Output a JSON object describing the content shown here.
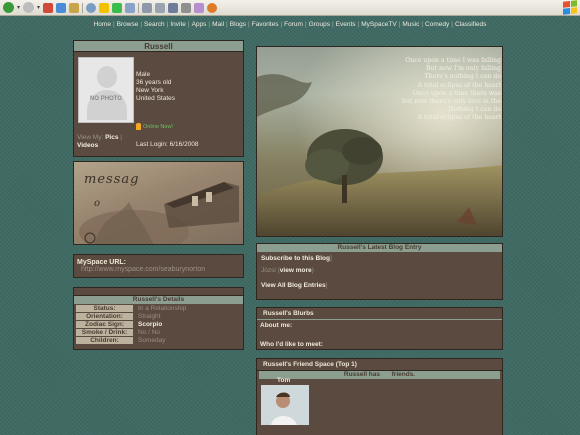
{
  "nav": [
    "Home",
    "Browse",
    "Search",
    "Invite",
    "Apps",
    "Mail",
    "Blogs",
    "Favorites",
    "Forum",
    "Groups",
    "Events",
    "MySpaceTV",
    "Music",
    "Comedy",
    "Classifieds"
  ],
  "profile": {
    "name": "Russell",
    "gender": "Male",
    "age": "36 years old",
    "city": "New York",
    "country": "United States",
    "online": "Online Now!",
    "last_login": "Last Login: 6/16/2008",
    "photo_text": "NO PHOTO",
    "view_my": "View My:",
    "pics": "Pics",
    "videos": "Videos"
  },
  "banner": {
    "text1": "messag",
    "text2": "o"
  },
  "url": {
    "label": "MySpace URL:",
    "value": "http://www.myspace.com/seaburynorton"
  },
  "details": {
    "title": "Russell's Details",
    "rows": [
      {
        "k": "Status:",
        "v": "In a Relationship",
        "strong": false
      },
      {
        "k": "Orientation:",
        "v": "Straight",
        "strong": false
      },
      {
        "k": "Zodiac Sign:",
        "v": "Scorpio",
        "strong": true
      },
      {
        "k": "Smoke / Drink:",
        "v": "No / No",
        "strong": false
      },
      {
        "k": "Children:",
        "v": "Someday",
        "strong": false
      }
    ]
  },
  "poem": [
    "Once upon a time I was falling",
    "But now I'm only falling",
    "There's nothing I can do",
    "A total eclipse of the heart",
    "Once upon a time there was",
    "but now there's only love in the",
    "Nothing I can do",
    "A total eclipse of the heart"
  ],
  "blog": {
    "title": "Russell's Latest Blog Entry",
    "subscribe": "Subscribe to this Blog",
    "entry": "Jòzsi",
    "view_more": "view more",
    "view_all": "View All Blog Entries"
  },
  "blurbs": {
    "title": "Russell's Blurbs",
    "about": "About me:",
    "meet": "Who I'd like to meet:"
  },
  "friends": {
    "title": "Russell's Friend Space (Top 1)",
    "has_prefix": "Russell has",
    "has_suffix": "friends.",
    "friend_name": "Tom"
  },
  "colors": {
    "background": "#3f6a63",
    "panel": "#5a4a40",
    "header": "#8b9e8f"
  }
}
